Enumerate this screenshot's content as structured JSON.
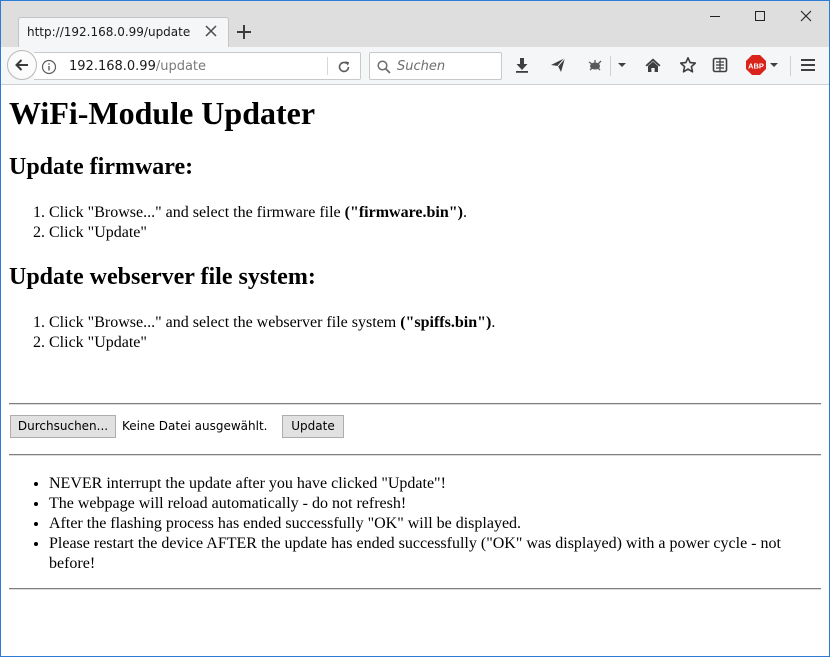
{
  "browser": {
    "tab": {
      "title": "http://192.168.0.99/update"
    },
    "url": {
      "host": "192.168.0.99",
      "path": "/update"
    },
    "search": {
      "placeholder": "Suchen"
    },
    "adblock_badge": "ABP"
  },
  "page": {
    "title": "WiFi-Module Updater",
    "firmware": {
      "heading": "Update firmware:",
      "step1_prefix": "Click \"Browse...\" and select the firmware file ",
      "step1_bold": "(\"firmware.bin\")",
      "step1_suffix": ".",
      "step2": "Click \"Update\""
    },
    "filesystem": {
      "heading": "Update webserver file system:",
      "step1_prefix": "Click \"Browse...\" and select the webserver file system ",
      "step1_bold": "(\"spiffs.bin\")",
      "step1_suffix": ".",
      "step2": "Click \"Update\""
    },
    "form": {
      "browse_label": "Durchsuchen...",
      "file_status": "Keine Datei ausgewählt.",
      "update_label": "Update"
    },
    "notes": [
      "NEVER interrupt the update after you have clicked \"Update\"!",
      "The webpage will reload automatically - do not refresh!",
      "After the flashing process has ended successfully \"OK\" will be displayed.",
      "Please restart the device AFTER the update has ended successfully (\"OK\" was displayed) with a power cycle - not before!"
    ]
  }
}
